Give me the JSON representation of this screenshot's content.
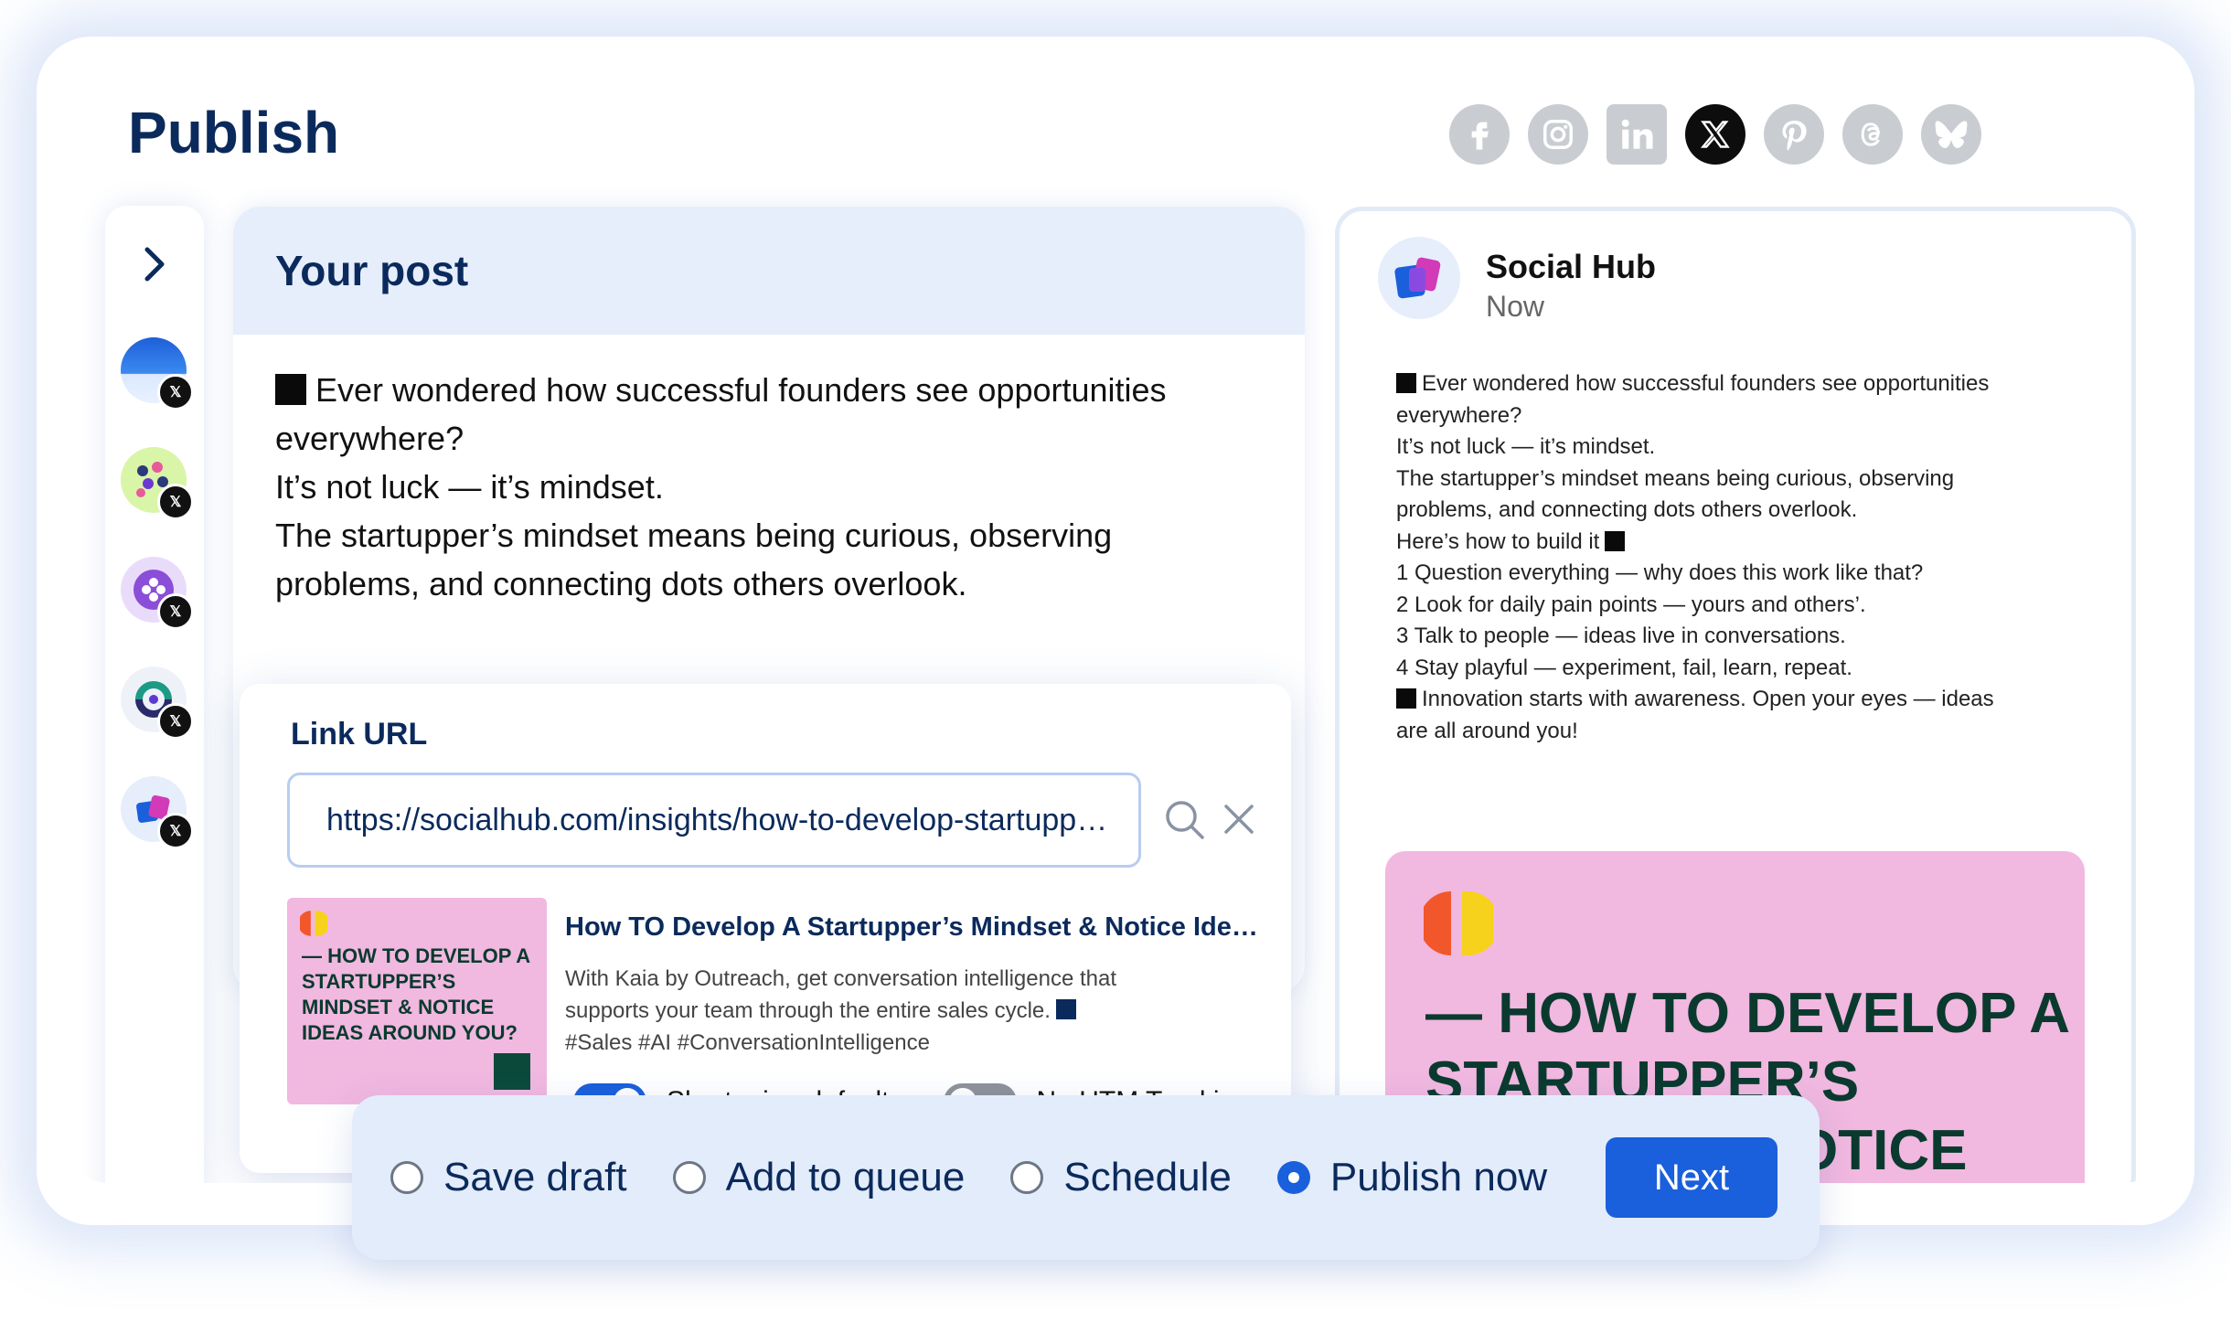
{
  "header": {
    "title": "Publish"
  },
  "social_networks": [
    {
      "name": "facebook-icon",
      "glyph": "f",
      "active": false
    },
    {
      "name": "instagram-icon",
      "glyph": "◎",
      "active": false
    },
    {
      "name": "linkedin-icon",
      "glyph": "in",
      "active": false
    },
    {
      "name": "x-icon",
      "glyph": "𝕏",
      "active": true
    },
    {
      "name": "pinterest-icon",
      "glyph": "P",
      "active": false
    },
    {
      "name": "threads-icon",
      "glyph": "@",
      "active": false
    },
    {
      "name": "bluesky-icon",
      "glyph": "🦋",
      "active": false
    }
  ],
  "accounts": [
    {
      "name": "account-1",
      "badge": "𝕏"
    },
    {
      "name": "account-2",
      "badge": "𝕏"
    },
    {
      "name": "account-3",
      "badge": "𝕏"
    },
    {
      "name": "account-4",
      "badge": "𝕏"
    },
    {
      "name": "account-5",
      "badge": "𝕏"
    }
  ],
  "post": {
    "heading": "Your post",
    "lines": [
      "Ever wondered how successful founders see opportunities",
      "everywhere?",
      "It’s not luck — it’s mindset.",
      "The startupper’s mindset means being curious, observing",
      "problems, and connecting dots others overlook."
    ]
  },
  "link": {
    "title": "Link URL",
    "url": "https://socialhub.com/insights/how-to-develop-startupper-mindset",
    "preview_title": "How TO Develop A Startupper’s Mindset & Notice Ideas Around You?",
    "preview_desc_1": "With Kaia by Outreach, get conversation intelligence that",
    "preview_desc_2": "supports your team through the entire sales cycle.",
    "preview_desc_3": "#Sales #AI #ConversationIntelligence",
    "thumb_text": "— HOW TO DEVELOP A STARTUPPER’S MINDSET & NOTICE IDEAS AROUND YOU?",
    "toggle_1_label": "Shortening defaults",
    "toggle_1_on": true,
    "toggle_2_label": "No UTM Tracking",
    "toggle_2_on": false
  },
  "preview": {
    "name": "Social Hub",
    "time": "Now",
    "lines": [
      {
        "prefix_square": true,
        "text": "Ever wondered how successful founders see opportunities"
      },
      {
        "prefix_square": false,
        "text": "everywhere?"
      },
      {
        "prefix_square": false,
        "text": "It’s not luck — it’s mindset."
      },
      {
        "prefix_square": false,
        "text": "The startupper’s mindset means being curious, observing"
      },
      {
        "prefix_square": false,
        "text": "problems, and connecting dots others overlook."
      },
      {
        "prefix_square": false,
        "text": "Here’s how to build it"
      },
      {
        "prefix_square": false,
        "text": " 1 Question everything — why does this work like that?"
      },
      {
        "prefix_square": false,
        "text": " 2 Look for daily pain points — yours and others’."
      },
      {
        "prefix_square": false,
        "text": " 3 Talk to people — ideas live in conversations."
      },
      {
        "prefix_square": false,
        "text": " 4 Stay playful — experiment, fail, learn, repeat."
      },
      {
        "prefix_square": true,
        "text": "Innovation starts with awareness. Open your eyes — ideas"
      },
      {
        "prefix_square": false,
        "text": "are all around you!"
      }
    ],
    "image_headline": "— HOW TO DEVELOP A STARTUPPER’S MINDSET & NOTICE IDEAS AROUND YOU?"
  },
  "actions": {
    "options": [
      {
        "label": "Save draft",
        "selected": false
      },
      {
        "label": "Add to queue",
        "selected": false
      },
      {
        "label": "Schedule",
        "selected": false
      },
      {
        "label": "Publish now",
        "selected": true
      }
    ],
    "next_label": "Next"
  },
  "colors": {
    "accent": "#1a5fdc",
    "navy": "#0b2a5c",
    "pink_card": "#f1b8e0",
    "dark_green": "#0a3a2e"
  }
}
